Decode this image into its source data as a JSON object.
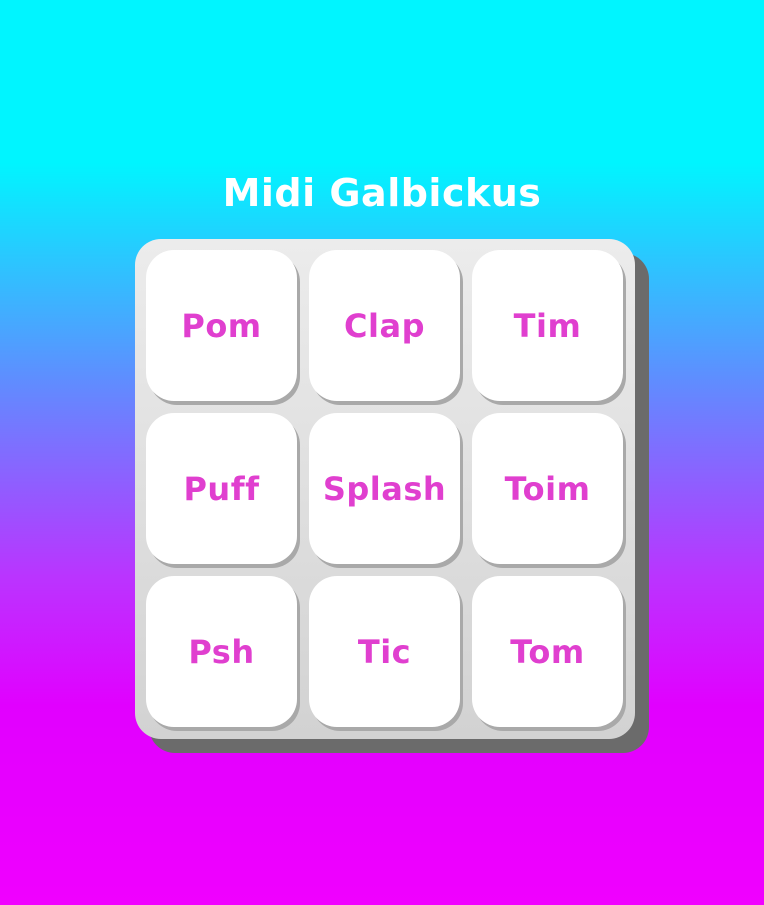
{
  "title": "Midi Galbickus",
  "pads": [
    {
      "label": "Pom"
    },
    {
      "label": "Clap"
    },
    {
      "label": "Tim"
    },
    {
      "label": "Puff"
    },
    {
      "label": "Splash"
    },
    {
      "label": "Toim"
    },
    {
      "label": "Psh"
    },
    {
      "label": "Tic"
    },
    {
      "label": "Tom"
    }
  ],
  "colors": {
    "background_top": "#00f5ff",
    "background_bottom": "#f000ff",
    "pad_label": "#e03fcf",
    "pad_face": "#ffffff",
    "board": "#dedede",
    "board_shadow": "#6b6b6b"
  }
}
